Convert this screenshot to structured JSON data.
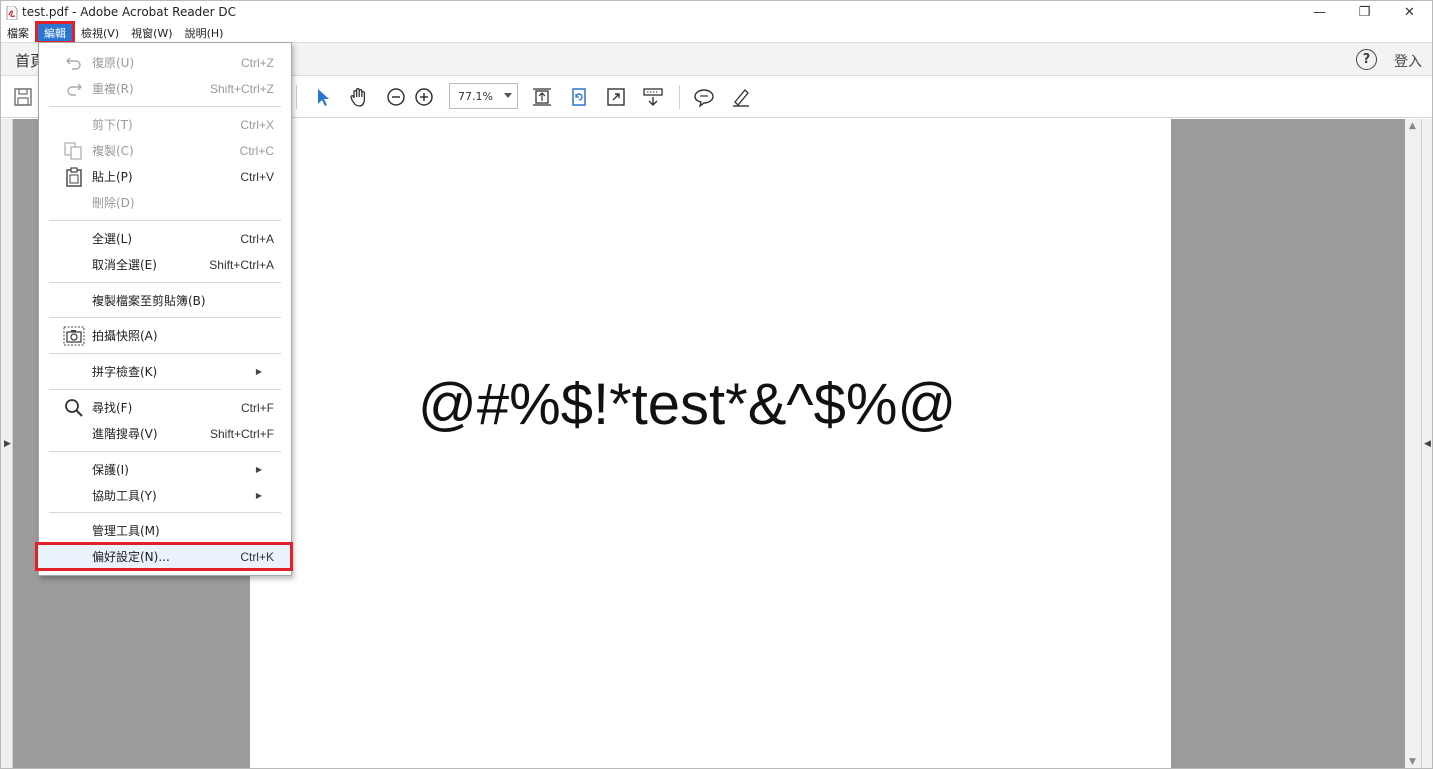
{
  "window": {
    "title": "test.pdf - Adobe Acrobat Reader DC",
    "minimize": "—",
    "restore": "❐",
    "close": "✕"
  },
  "menubar": {
    "items": [
      "檔案",
      "編輯",
      "檢視(V)",
      "視窗(W)",
      "說明(H)"
    ],
    "active_index": 1
  },
  "tabs": {
    "home": "首頁",
    "help": "?",
    "signin": "登入"
  },
  "toolbar": {
    "zoom": "77.1%"
  },
  "document": {
    "text": "@#%$!*test*&^$%@"
  },
  "edit_menu": {
    "undo": {
      "label": "復原(U)",
      "shortcut": "Ctrl+Z"
    },
    "redo": {
      "label": "重複(R)",
      "shortcut": "Shift+Ctrl+Z"
    },
    "cut": {
      "label": "剪下(T)",
      "shortcut": "Ctrl+X"
    },
    "copy": {
      "label": "複製(C)",
      "shortcut": "Ctrl+C"
    },
    "paste": {
      "label": "貼上(P)",
      "shortcut": "Ctrl+V"
    },
    "delete": {
      "label": "刪除(D)",
      "shortcut": ""
    },
    "select_all": {
      "label": "全選(L)",
      "shortcut": "Ctrl+A"
    },
    "deselect_all": {
      "label": "取消全選(E)",
      "shortcut": "Shift+Ctrl+A"
    },
    "copy_file": {
      "label": "複製檔案至剪貼簿(B)",
      "shortcut": ""
    },
    "snapshot": {
      "label": "拍攝快照(A)",
      "shortcut": ""
    },
    "spelling": {
      "label": "拼字檢查(K)",
      "shortcut": ""
    },
    "find": {
      "label": "尋找(F)",
      "shortcut": "Ctrl+F"
    },
    "advanced_search": {
      "label": "進階搜尋(V)",
      "shortcut": "Shift+Ctrl+F"
    },
    "protection": {
      "label": "保護(I)",
      "shortcut": ""
    },
    "accessibility": {
      "label": "協助工具(Y)",
      "shortcut": ""
    },
    "manage_tools": {
      "label": "管理工具(M)",
      "shortcut": ""
    },
    "preferences": {
      "label": "偏好設定(N)...",
      "shortcut": "Ctrl+K"
    }
  },
  "colors": {
    "menu_active_bg": "#2a76d2",
    "highlight_outline": "#e0202a",
    "doc_background": "#9b9b9b",
    "tool_blue": "#2a76d2"
  }
}
